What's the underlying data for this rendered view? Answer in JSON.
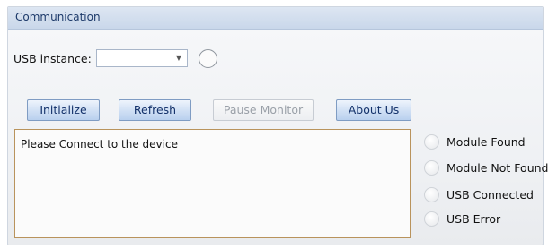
{
  "group": {
    "title": "Communication"
  },
  "usb": {
    "label": "USB instance:",
    "selected": "",
    "chevron": "▼"
  },
  "buttons": [
    {
      "label": "Initialize",
      "enabled": true
    },
    {
      "label": "Refresh",
      "enabled": true
    },
    {
      "label": "Pause Monitor",
      "enabled": false
    },
    {
      "label": "About Us",
      "enabled": true
    }
  ],
  "log": {
    "text": "Please Connect to the device"
  },
  "indicators": [
    {
      "label": "Module Found"
    },
    {
      "label": "Module Not Found"
    },
    {
      "label": "USB Connected"
    },
    {
      "label": "USB Error"
    }
  ],
  "colors": {
    "button_text": "#13316a",
    "log_border": "#b9935c",
    "header": "#c9d7ea"
  }
}
